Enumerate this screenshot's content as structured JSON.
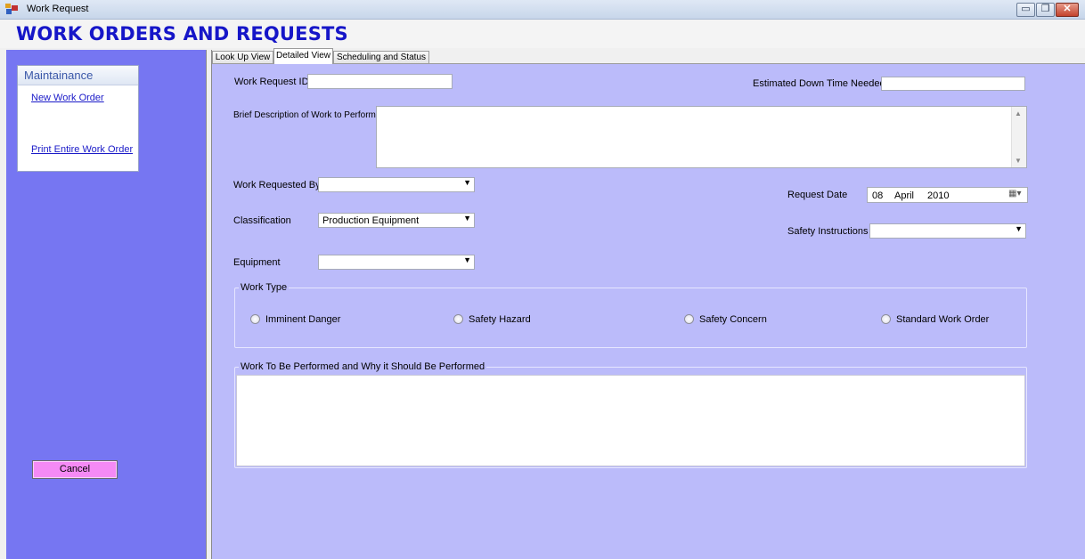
{
  "window": {
    "title": "Work Request"
  },
  "header": {
    "title": "WORK ORDERS AND REQUESTS"
  },
  "sidebar": {
    "section_title": "Maintainance",
    "links": [
      {
        "label": "New Work Order"
      },
      {
        "label": "Print Entire Work Order"
      }
    ],
    "cancel_label": "Cancel"
  },
  "tabs": [
    {
      "label": "Look Up View"
    },
    {
      "label": "Detailed View",
      "active": true
    },
    {
      "label": "Scheduling and Status"
    }
  ],
  "form": {
    "work_request_id": {
      "label": "Work Request ID",
      "value": ""
    },
    "est_down_time": {
      "label": "Estimated Down Time Needed",
      "value": ""
    },
    "description": {
      "label": "Brief Description of Work to Perform",
      "value": ""
    },
    "requested_by": {
      "label": "Work Requested By",
      "value": ""
    },
    "classification": {
      "label": "Classification",
      "value": "Production Equipment"
    },
    "equipment": {
      "label": "Equipment",
      "value": ""
    },
    "request_date": {
      "label": "Request Date",
      "day": "08",
      "month": "April",
      "year": "2010"
    },
    "safety_instructions": {
      "label": "Safety Instructions",
      "value": ""
    },
    "work_type": {
      "legend": "Work Type",
      "options": [
        "Imminent Danger",
        "Safety Hazard",
        "Safety Concern",
        "Standard Work Order"
      ]
    },
    "work_performed": {
      "legend": "Work To Be Performed and Why it Should Be Performed",
      "value": ""
    }
  },
  "colors": {
    "sidebar_bg": "#7676f2",
    "content_bg": "#bbbbfa",
    "title_color": "#1616c8",
    "cancel_bg": "#f58af5"
  }
}
